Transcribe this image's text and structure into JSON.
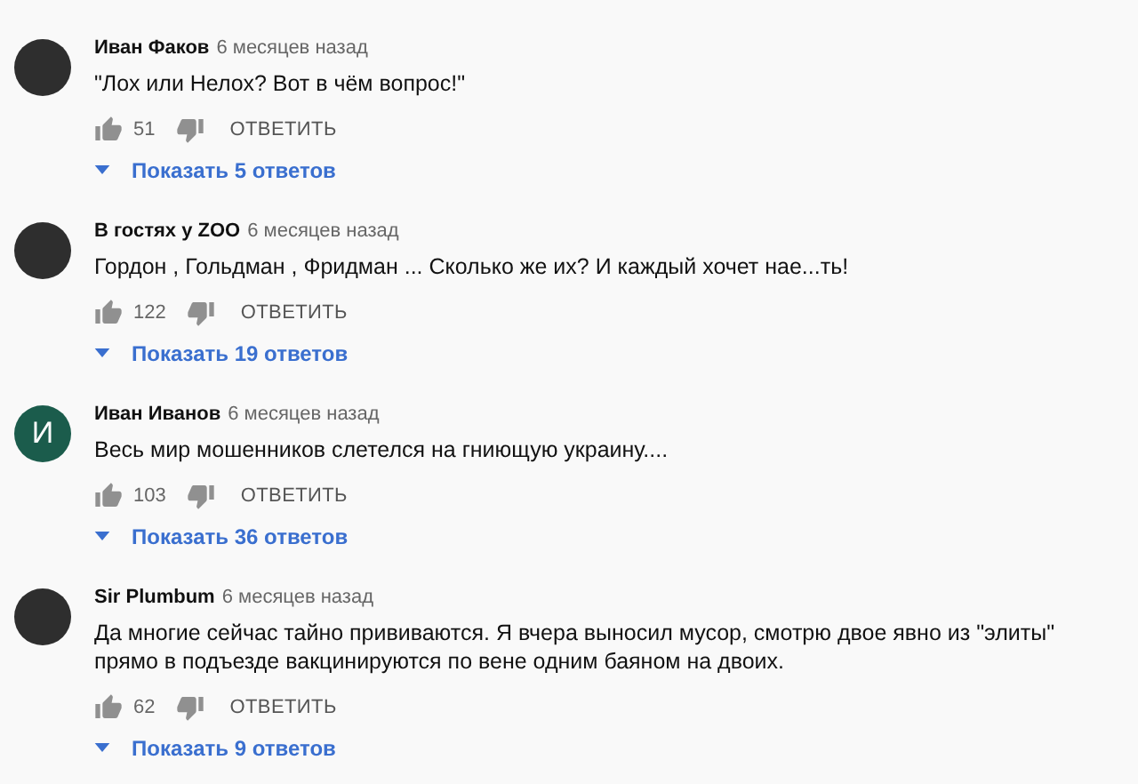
{
  "comments": [
    {
      "author": "Иван Факов",
      "time": "6 месяцев назад",
      "text": "\"Лох или Нелох? Вот в чём вопрос!\"",
      "avatar": {
        "kind": "photo"
      },
      "likes": "51",
      "reply_label": "ОТВЕТИТЬ",
      "replies_label": "Показать 5 ответов",
      "replies_expanded": false
    },
    {
      "author": "В гостях у ZOO",
      "time": "6 месяцев назад",
      "text": "Гордон , Гольдман , Фридман ... Сколько же их? И каждый хочет нае...ть!",
      "avatar": {
        "kind": "photo"
      },
      "likes": "122",
      "reply_label": "ОТВЕТИТЬ",
      "replies_label": "Показать 19 ответов",
      "replies_expanded": false
    },
    {
      "author": "Иван Иванов",
      "time": "6 месяцев назад",
      "text": "Весь мир мошенников слетелся на гниющую украину....",
      "avatar": {
        "kind": "letter",
        "letter": "И",
        "color": "#1b5c4c"
      },
      "likes": "103",
      "reply_label": "ОТВЕТИТЬ",
      "replies_label": "Показать 36 ответов",
      "replies_expanded": false
    },
    {
      "author": "Sir Plumbum",
      "time": "6 месяцев назад",
      "text": "Да многие сейчас тайно прививаются. Я вчера выносил мусор, смотрю двое явно из  \"элиты\" прямо в подъезде вакцинируются по вене одним баяном на двоих.",
      "avatar": {
        "kind": "photo"
      },
      "likes": "62",
      "reply_label": "ОТВЕТИТЬ",
      "replies_label": "Показать 9 ответов",
      "replies_expanded": false
    }
  ]
}
